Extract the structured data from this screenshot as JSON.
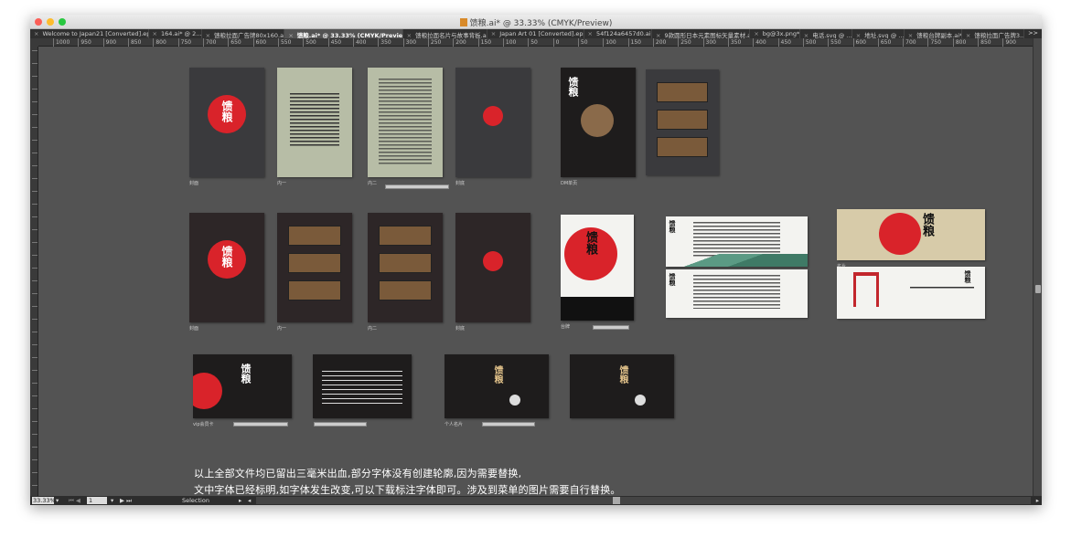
{
  "window": {
    "title": "馈粮.ai* @ 33.33% (CMYK/Preview)"
  },
  "tabs": [
    {
      "label": "Welcome to Japan21 [Converted].eps*"
    },
    {
      "label": "164.ai* @ 2..."
    },
    {
      "label": "馈粮拉面广告牌80x160.ai*"
    },
    {
      "label": "馈粮.ai* @ 33.33% (CMYK/Preview)",
      "active": true
    },
    {
      "label": "馈粮拉面名片与故事背板.ai*"
    },
    {
      "label": "Japan Art 01 [Converted].eps*"
    },
    {
      "label": "54f124a6457d0.ai*"
    },
    {
      "label": "9款圆形日本元素图标矢量素材.ai*"
    },
    {
      "label": "bg@3x.png*"
    },
    {
      "label": "电话.svg @ ..."
    },
    {
      "label": "地址.svg @ ..."
    },
    {
      "label": "馈粮台牌副本.ai*"
    },
    {
      "label": "馈粮拉面广告牌3..."
    }
  ],
  "tabs_overflow": ">>",
  "ruler": [
    "1000",
    "950",
    "900",
    "850",
    "800",
    "750",
    "700",
    "650",
    "600",
    "550",
    "500",
    "450",
    "400",
    "350",
    "300",
    "250",
    "200",
    "150",
    "100",
    "50",
    "0",
    "50",
    "100",
    "150",
    "200",
    "250",
    "300",
    "350",
    "400",
    "450",
    "500",
    "550",
    "600",
    "650",
    "700",
    "750",
    "800",
    "850",
    "900"
  ],
  "artwork_logo": "馈粮",
  "artboards": [
    {
      "label": "封面"
    },
    {
      "label": "内一"
    },
    {
      "label": "内二"
    },
    {
      "label": "封底"
    },
    {
      "label": "DM单页"
    },
    {
      "label": ""
    },
    {
      "label": "封面"
    },
    {
      "label": "内一"
    },
    {
      "label": "内二"
    },
    {
      "label": "封底"
    },
    {
      "label": "台牌"
    },
    {
      "label": "故事板"
    },
    {
      "label": ""
    },
    {
      "label": "名片"
    },
    {
      "label": ""
    },
    {
      "label": "vip会员卡"
    },
    {
      "label": ""
    },
    {
      "label": "个人名片"
    },
    {
      "label": ""
    }
  ],
  "notes": [
    "以上全部文件均已留出三毫米出血,部分字体没有创建轮廓,因为需要替换,",
    "文中字体已经标明,如字体发生改变,可以下载标注字体即可。涉及到菜单的图片需要自行替换。"
  ],
  "status": {
    "zoom": "33.33%",
    "page": "1",
    "tool": "Selection"
  }
}
